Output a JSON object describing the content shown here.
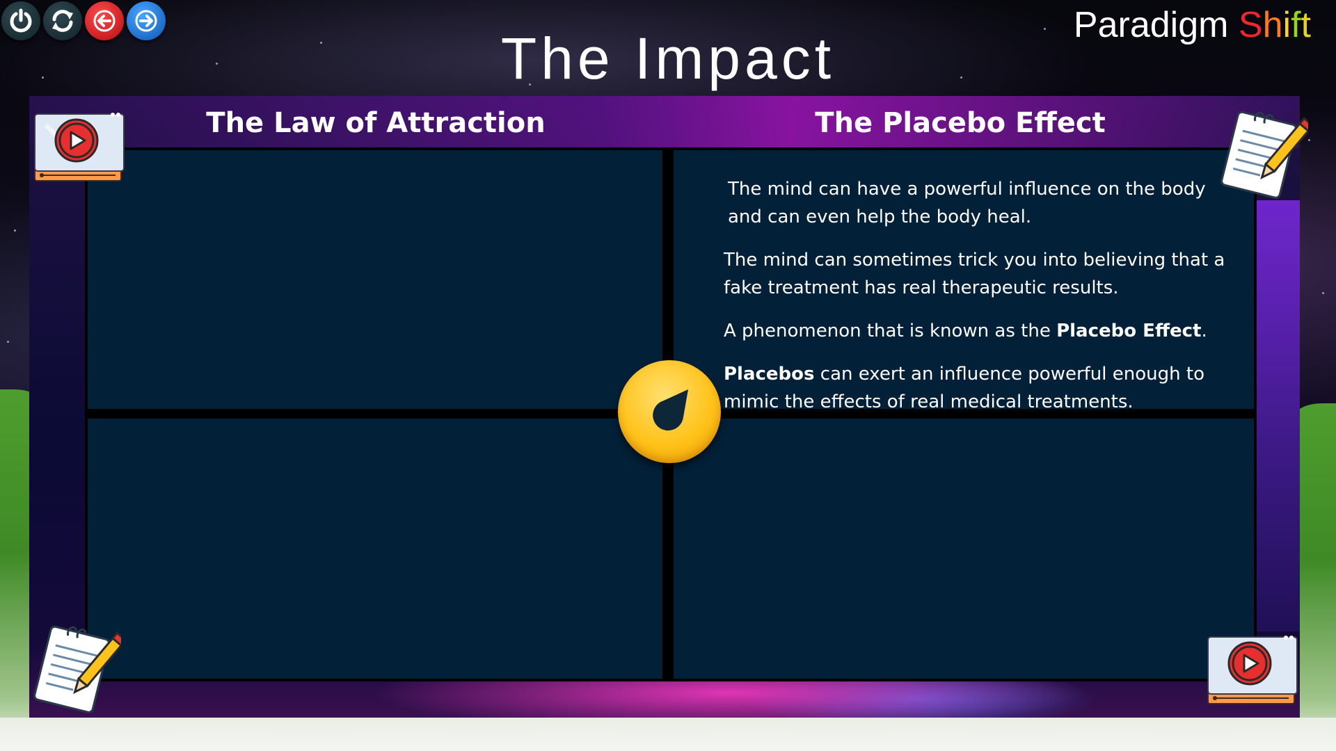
{
  "nav": {
    "buttons": [
      {
        "name": "power-icon"
      },
      {
        "name": "refresh-icon"
      },
      {
        "name": "arrow-left-icon"
      },
      {
        "name": "arrow-right-icon"
      }
    ]
  },
  "header": {
    "title": "The Impact",
    "brand": {
      "word1": "Paradigm",
      "word2_letters": [
        "S",
        "h",
        "i",
        "f",
        "t"
      ]
    }
  },
  "columns": {
    "left_heading": "The Law of Attraction",
    "right_heading": "The Placebo Effect"
  },
  "placebo": {
    "p1": "The mind can have a powerful influence on the body and can even help the body heal.",
    "p2": "The mind can sometimes trick you into believing that a fake treatment has real therapeutic results.",
    "p3_prefix": "A phenomenon that is known as the ",
    "p3_bold": "Placebo Effect",
    "p3_suffix": ".",
    "p4_bold": "Placebos",
    "p4_rest": " can exert an influence powerful enough to mimic the effects of real medical treatments."
  },
  "icons": {
    "center": "compass-icon",
    "video": "video-player-icon",
    "notes": "notepad-pencil-icon"
  },
  "colors": {
    "cell_bg": "#022038",
    "badge": "#ffc21a",
    "shift_s": "#f0262a",
    "shift_h": "#ff7a1a",
    "shift_i": "#ffd21e",
    "shift_f": "#9bd31a",
    "shift_t": "#e6d21e"
  }
}
